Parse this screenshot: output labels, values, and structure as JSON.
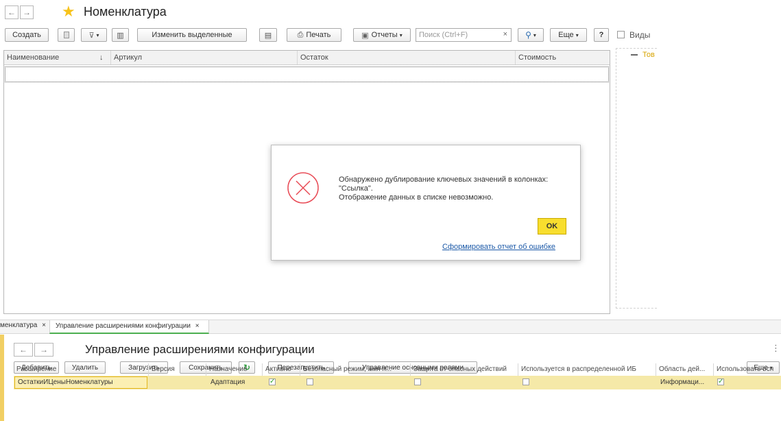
{
  "top_window": {
    "title": "Номенклатура",
    "toolbar": {
      "create": "Создать",
      "edit_selected": "Изменить выделенные",
      "print": "Печать",
      "reports": "Отчеты",
      "search_placeholder": "Поиск (Ctrl+F)",
      "search_clear": "×",
      "more": "Еще",
      "help": "?"
    },
    "columns": [
      "Наименование",
      "Артикул",
      "Остаток",
      "Стоимость"
    ],
    "sort_arrow": "↓",
    "side_panel": {
      "label": "Виды",
      "item": "Тов"
    }
  },
  "error_dialog": {
    "message_line1": "Обнаружено дублирование ключевых значений в колонках:",
    "message_line2": "\"Ссылка\".",
    "message_line3": "Отображение данных в списке невозможно.",
    "ok": "OK",
    "report_link": "Сформировать отчет об ошибке",
    "accent": "#e84a55",
    "ok_color": "#f8de2e"
  },
  "tabs": [
    {
      "label": "менклатура",
      "close": "×"
    },
    {
      "label": "Управление расширениями конфигурации",
      "close": "×"
    }
  ],
  "bottom_window": {
    "title": "Управление расширениями конфигурации",
    "toolbar": {
      "add": "Добавить",
      "delete": "Удалить",
      "load": "Загрузить",
      "save": "Сохранить",
      "restart": "Перезапустить",
      "roles": "Управление основными ролями",
      "more": "Еще",
      "menu_dots": "⋮"
    },
    "columns": [
      "Расширение",
      "Версия",
      "Назначение",
      "Активно",
      "Безопасный режим, имя п...",
      "Защита от опасных действий",
      "Используется в распределенной ИБ",
      "Область дей...",
      "Использовать осн"
    ],
    "rows": [
      {
        "name": "ОстаткиИЦеныНоменклатуры",
        "version": "",
        "purpose": "Адаптация",
        "active": true,
        "safe_mode": false,
        "protection": false,
        "distributed": false,
        "scope": "Информаци...",
        "use_main": true
      }
    ]
  }
}
